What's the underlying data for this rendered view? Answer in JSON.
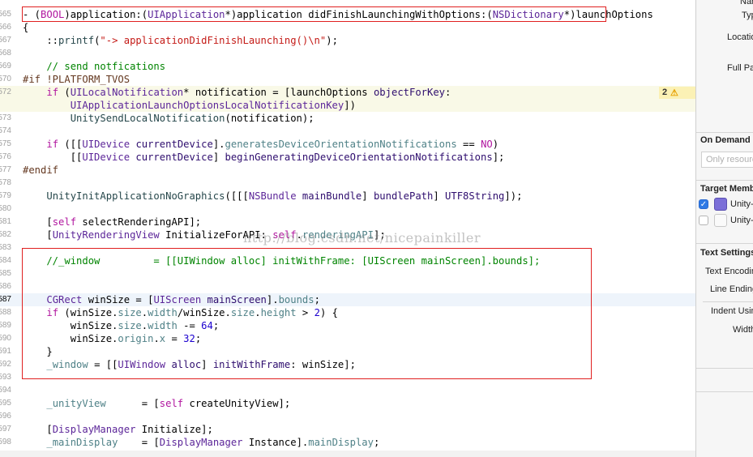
{
  "editor": {
    "lines": [
      {
        "num": "565",
        "tokens": [
          [
            "plain",
            "- ("
          ],
          [
            "kw",
            "BOOL"
          ],
          [
            "plain",
            ")application:("
          ],
          [
            "cls",
            "UIApplication"
          ],
          [
            "plain",
            "*)application didFinishLaunchingWithOptions:("
          ],
          [
            "cls",
            "NSDictionary"
          ],
          [
            "plain",
            "*)launchOptions"
          ]
        ]
      },
      {
        "num": "566",
        "tokens": [
          [
            "plain",
            "{"
          ]
        ]
      },
      {
        "num": "567",
        "tokens": [
          [
            "plain",
            "    ::"
          ],
          [
            "fn",
            "printf"
          ],
          [
            "plain",
            "("
          ],
          [
            "str",
            "\"-> applicationDidFinishLaunching()\\n\""
          ],
          [
            "plain",
            ");"
          ]
        ]
      },
      {
        "num": "568",
        "tokens": []
      },
      {
        "num": "569",
        "tokens": [
          [
            "cm",
            "    // send notfications"
          ]
        ]
      },
      {
        "num": "570",
        "tokens": [
          [
            "pp",
            "#if !PLATFORM_TVOS"
          ]
        ]
      },
      {
        "num": "572",
        "tokens": [
          [
            "plain",
            "    "
          ],
          [
            "kw",
            "if"
          ],
          [
            "plain",
            " ("
          ],
          [
            "cls",
            "UILocalNotification"
          ],
          [
            "plain",
            "* notification = [launchOptions "
          ],
          [
            "mt",
            "objectForKey"
          ],
          [
            "plain",
            ":"
          ]
        ]
      },
      {
        "num": "",
        "tokens": [
          [
            "plain",
            "        "
          ],
          [
            "cls",
            "UIApplicationLaunchOptionsLocalNotificationKey"
          ],
          [
            "plain",
            "])"
          ]
        ]
      },
      {
        "num": "573",
        "tokens": [
          [
            "plain",
            "        "
          ],
          [
            "fn",
            "UnitySendLocalNotification"
          ],
          [
            "plain",
            "(notification);"
          ]
        ]
      },
      {
        "num": "574",
        "tokens": []
      },
      {
        "num": "575",
        "tokens": [
          [
            "plain",
            "    "
          ],
          [
            "kw",
            "if"
          ],
          [
            "plain",
            " ([["
          ],
          [
            "cls",
            "UIDevice"
          ],
          [
            "plain",
            " "
          ],
          [
            "mt",
            "currentDevice"
          ],
          [
            "plain",
            "]."
          ],
          [
            "pr",
            "generatesDeviceOrientationNotifications"
          ],
          [
            "plain",
            " == "
          ],
          [
            "kw",
            "NO"
          ],
          [
            "plain",
            ")"
          ]
        ]
      },
      {
        "num": "576",
        "tokens": [
          [
            "plain",
            "        [["
          ],
          [
            "cls",
            "UIDevice"
          ],
          [
            "plain",
            " "
          ],
          [
            "mt",
            "currentDevice"
          ],
          [
            "plain",
            "] "
          ],
          [
            "mt",
            "beginGeneratingDeviceOrientationNotifications"
          ],
          [
            "plain",
            "];"
          ]
        ]
      },
      {
        "num": "577",
        "tokens": [
          [
            "pp",
            "#endif"
          ]
        ]
      },
      {
        "num": "578",
        "tokens": []
      },
      {
        "num": "579",
        "tokens": [
          [
            "plain",
            "    "
          ],
          [
            "fn",
            "UnityInitApplicationNoGraphics"
          ],
          [
            "plain",
            "([[["
          ],
          [
            "cls",
            "NSBundle"
          ],
          [
            "plain",
            " "
          ],
          [
            "mt",
            "mainBundle"
          ],
          [
            "plain",
            "] "
          ],
          [
            "mt",
            "bundlePath"
          ],
          [
            "plain",
            "] "
          ],
          [
            "mt",
            "UTF8String"
          ],
          [
            "plain",
            "]);"
          ]
        ]
      },
      {
        "num": "580",
        "tokens": []
      },
      {
        "num": "581",
        "tokens": [
          [
            "plain",
            "    ["
          ],
          [
            "kw",
            "self"
          ],
          [
            "plain",
            " selectRenderingAPI];"
          ]
        ]
      },
      {
        "num": "582",
        "tokens": [
          [
            "plain",
            "    ["
          ],
          [
            "cls",
            "UnityRenderingView"
          ],
          [
            "plain",
            " InitializeForAPI: "
          ],
          [
            "kw",
            "self"
          ],
          [
            "plain",
            "."
          ],
          [
            "pr",
            "renderingAPI"
          ],
          [
            "plain",
            "];"
          ]
        ]
      },
      {
        "num": "583",
        "tokens": []
      },
      {
        "num": "584",
        "tokens": [
          [
            "cm",
            "    //_window         = [[UIWindow alloc] initWithFrame: [UIScreen mainScreen].bounds];"
          ]
        ]
      },
      {
        "num": "585",
        "tokens": []
      },
      {
        "num": "586",
        "tokens": []
      },
      {
        "num": "587",
        "tokens": [
          [
            "plain",
            "    "
          ],
          [
            "cls",
            "CGRect"
          ],
          [
            "plain",
            " winSize = ["
          ],
          [
            "cls",
            "UIScreen"
          ],
          [
            "plain",
            " "
          ],
          [
            "mt",
            "mainScreen"
          ],
          [
            "plain",
            "]."
          ],
          [
            "pr",
            "bounds"
          ],
          [
            "plain",
            ";"
          ]
        ]
      },
      {
        "num": "588",
        "tokens": [
          [
            "plain",
            "    "
          ],
          [
            "kw",
            "if"
          ],
          [
            "plain",
            " (winSize."
          ],
          [
            "pr",
            "size"
          ],
          [
            "plain",
            "."
          ],
          [
            "pr",
            "width"
          ],
          [
            "plain",
            "/winSize."
          ],
          [
            "pr",
            "size"
          ],
          [
            "plain",
            "."
          ],
          [
            "pr",
            "height"
          ],
          [
            "plain",
            " > "
          ],
          [
            "num",
            "2"
          ],
          [
            "plain",
            ") {"
          ]
        ]
      },
      {
        "num": "589",
        "tokens": [
          [
            "plain",
            "        winSize."
          ],
          [
            "pr",
            "size"
          ],
          [
            "plain",
            "."
          ],
          [
            "pr",
            "width"
          ],
          [
            "plain",
            " -= "
          ],
          [
            "num",
            "64"
          ],
          [
            "plain",
            ";"
          ]
        ]
      },
      {
        "num": "590",
        "tokens": [
          [
            "plain",
            "        winSize."
          ],
          [
            "pr",
            "origin"
          ],
          [
            "plain",
            "."
          ],
          [
            "pr",
            "x"
          ],
          [
            "plain",
            " = "
          ],
          [
            "num",
            "32"
          ],
          [
            "plain",
            ";"
          ]
        ]
      },
      {
        "num": "591",
        "tokens": [
          [
            "plain",
            "    }"
          ]
        ]
      },
      {
        "num": "592",
        "tokens": [
          [
            "plain",
            "    "
          ],
          [
            "pr",
            "_window"
          ],
          [
            "plain",
            " = [["
          ],
          [
            "cls",
            "UIWindow"
          ],
          [
            "plain",
            " "
          ],
          [
            "mt",
            "alloc"
          ],
          [
            "plain",
            "] "
          ],
          [
            "mt",
            "initWithFrame"
          ],
          [
            "plain",
            ": winSize];"
          ]
        ]
      },
      {
        "num": "593",
        "tokens": []
      },
      {
        "num": "594",
        "tokens": []
      },
      {
        "num": "595",
        "tokens": [
          [
            "plain",
            "    "
          ],
          [
            "pr",
            "_unityView"
          ],
          [
            "plain",
            "      = ["
          ],
          [
            "kw",
            "self"
          ],
          [
            "plain",
            " createUnityView];"
          ]
        ]
      },
      {
        "num": "596",
        "tokens": []
      },
      {
        "num": "597",
        "tokens": [
          [
            "plain",
            "    ["
          ],
          [
            "cls",
            "DisplayManager"
          ],
          [
            "plain",
            " Initialize];"
          ]
        ]
      },
      {
        "num": "598",
        "tokens": [
          [
            "plain",
            "    "
          ],
          [
            "pr",
            "_mainDisplay"
          ],
          [
            "plain",
            "    = ["
          ],
          [
            "cls",
            "DisplayManager"
          ],
          [
            "plain",
            " Instance]."
          ],
          [
            "pr",
            "mainDisplay"
          ],
          [
            "plain",
            ";"
          ]
        ]
      }
    ],
    "warning_count": "2",
    "warning_icon": "warning-triangle-icon",
    "watermark": "http://blog.csdn.net/nicepainkiller"
  },
  "inspector": {
    "name_label": "Name",
    "type_label": "Type",
    "location_label": "Location",
    "fullpath_label": "Full Path",
    "on_demand_header": "On Demand Resource Tags",
    "on_demand_placeholder": "Only resources are taggable",
    "target_header": "Target Membership",
    "targets": [
      {
        "label": "Unity-iPhone",
        "checked": true,
        "icon": "unity-app-icon"
      },
      {
        "label": "Unity-iPhone Tests",
        "checked": false,
        "icon": "test-bundle-icon"
      }
    ],
    "text_settings_header": "Text Settings",
    "text_encoding_label": "Text Encoding",
    "line_endings_label": "Line Endings",
    "indent_using_label": "Indent Using",
    "widths_label": "Widths"
  },
  "colors": {
    "keyword": "#b1169f",
    "class": "#5c2699",
    "comment": "#008400",
    "string": "#c41a16",
    "number": "#1c00cf",
    "highlight_box": "#e02020",
    "current_line": "#eef4fb",
    "warning_line": "#f9f9e7"
  }
}
